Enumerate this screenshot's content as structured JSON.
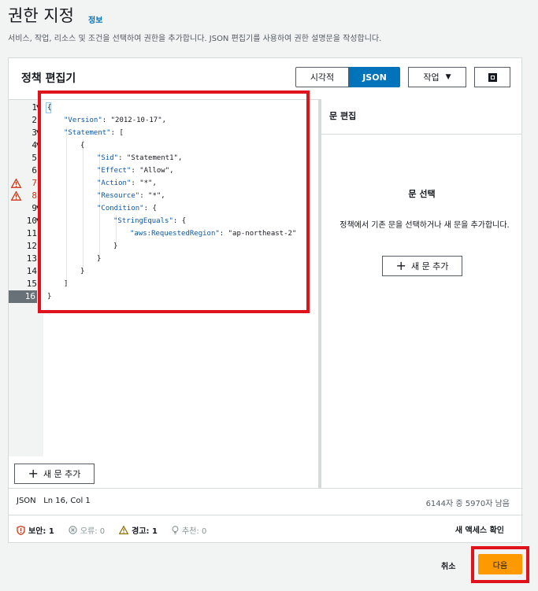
{
  "header": {
    "title": "권한 지정",
    "info_link": "정보",
    "description": "서비스, 작업, 리소스 및 조건을 선택하여 권한을 추가합니다. JSON 편집기를 사용하여 권한 설명문을 작성합니다."
  },
  "panel": {
    "title": "정책 편집기",
    "mode_visual": "시각적",
    "mode_json": "JSON",
    "action_label": "작업",
    "action_caret": "▼"
  },
  "editor": {
    "line_numbers": [
      "1",
      "2",
      "3",
      "4",
      "5",
      "6",
      "7",
      "8",
      "9",
      "10",
      "11",
      "12",
      "13",
      "14",
      "15",
      "16"
    ],
    "warning_lines": [
      "7",
      "8"
    ],
    "active_line": "16",
    "code": {
      "l1": "{",
      "l2_key": "\"Version\"",
      "l2_val": ": \"2012-10-17\",",
      "l3_key": "\"Statement\"",
      "l3_val": ": [",
      "l4": "{",
      "l5_key": "\"Sid\"",
      "l5_val": ": \"Statement1\",",
      "l6_key": "\"Effect\"",
      "l6_val": ": \"Allow\",",
      "l7_key": "\"Action\"",
      "l7_val": ": \"*\",",
      "l8_key": "\"Resource\"",
      "l8_val": ": \"*\",",
      "l9_key": "\"Condition\"",
      "l9_val": ": {",
      "l10_key": "\"StringEquals\"",
      "l10_val": ": {",
      "l11_key": "\"aws:RequestedRegion\"",
      "l11_val": ": \"ap-northeast-2\"",
      "l12": "}",
      "l13": "}",
      "l14": "}",
      "l15": "]",
      "l16": "}"
    },
    "add_statement": "새 문 추가"
  },
  "statement_pane": {
    "title": "문 편집",
    "select_title": "문 선택",
    "select_desc": "정책에서 기존 문을 선택하거나 새 문을 추가합니다.",
    "add_statement": "새 문 추가"
  },
  "status": {
    "mode": "JSON",
    "position": "Ln 16, Col 1",
    "remaining": "6144자 중 5970자 남음"
  },
  "validation": {
    "security": "보안: 1",
    "errors": "오류: 0",
    "warnings": "경고: 1",
    "suggestions": "추천: 0",
    "review_access": "새 액세스 확인"
  },
  "actions": {
    "cancel": "취소",
    "next": "다음"
  },
  "colors": {
    "accent": "#0073bb",
    "primary_button": "#ff9900",
    "annotation": "#e0121b",
    "warning": "#d13212"
  }
}
